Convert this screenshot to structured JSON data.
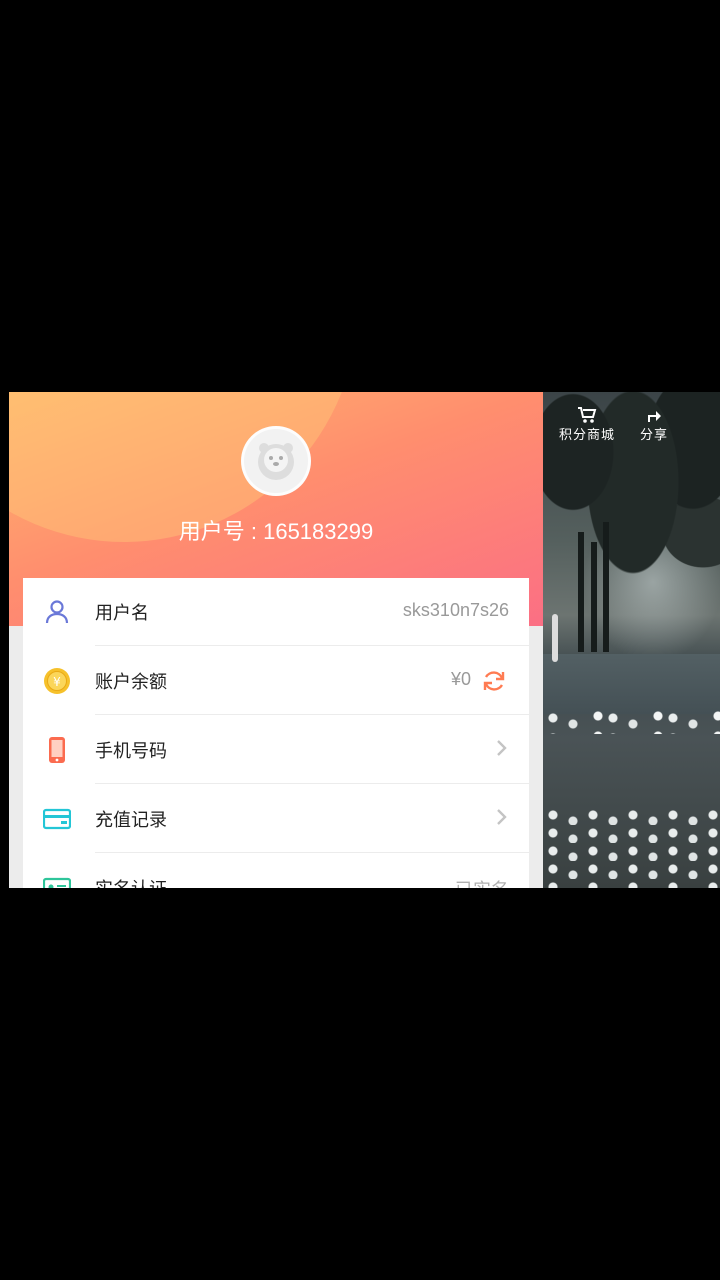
{
  "header": {
    "user_id_text": "用户号 : 165183299"
  },
  "rows": [
    {
      "label": "用户名",
      "value": "sks310n7s26",
      "icon": "user-icon"
    },
    {
      "label": "账户余额",
      "value": "¥0",
      "icon": "coin-icon",
      "action_icon": "refresh-icon"
    },
    {
      "label": "手机号码",
      "value": "",
      "icon": "phone-icon",
      "action_icon": "chevron-right-icon"
    },
    {
      "label": "充值记录",
      "value": "",
      "icon": "card-icon",
      "action_icon": "chevron-right-icon"
    },
    {
      "label": "实名认证",
      "value": "已实名",
      "icon": "id-card-icon"
    }
  ],
  "scene": {
    "points_mall_label": "积分商城",
    "share_label": "分享"
  },
  "colors": {
    "accent_orange": "#ff8a5b",
    "gradient_start": "#ffb76c",
    "gradient_end": "#fb6f84",
    "icon_user": "#6a78d8",
    "icon_coin": "#f6c12b",
    "icon_phone": "#fb6b4f",
    "icon_card": "#23c6d6",
    "icon_id": "#2ec59a"
  }
}
